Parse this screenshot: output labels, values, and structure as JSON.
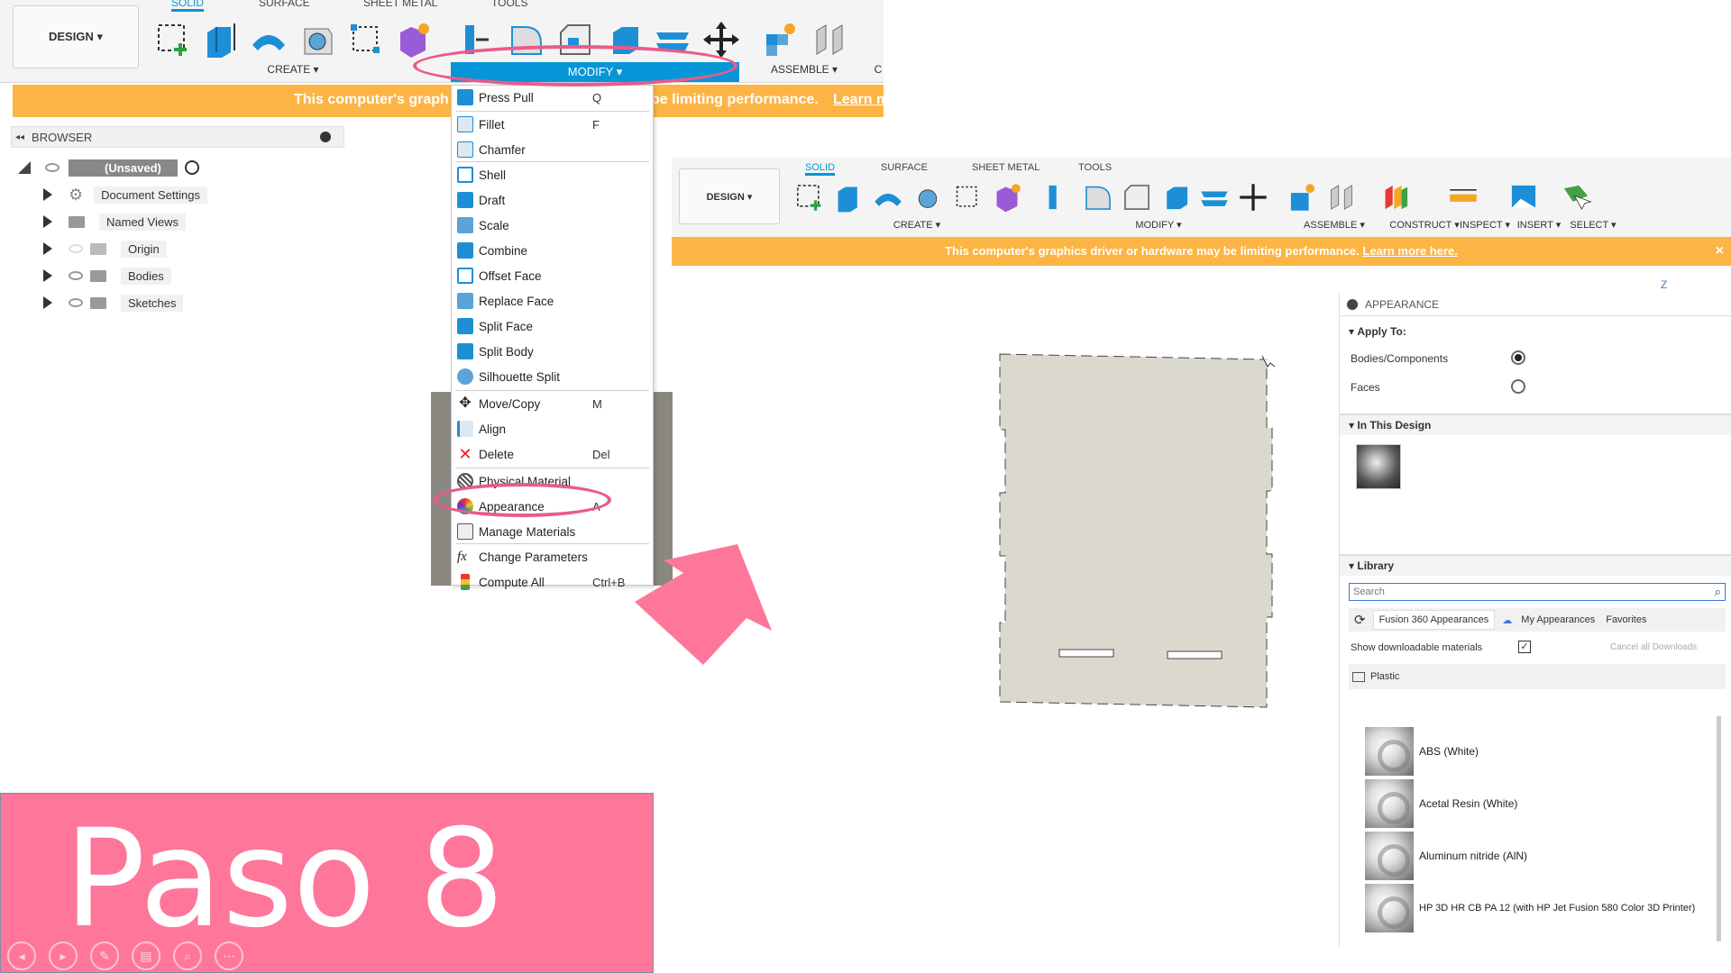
{
  "left": {
    "design_label": "DESIGN ▾",
    "tabs": [
      "SOLID",
      "SURFACE",
      "SHEET METAL",
      "TOOLS"
    ],
    "groups": {
      "create": "CREATE ▾",
      "modify": "MODIFY ▾",
      "assemble": "ASSEMBLE ▾",
      "construct_partial": "C"
    },
    "warning": "This computer's graphics driver or hardware may be limiting performance.",
    "warning_left_visible": "This computer's graph",
    "warning_right_visible": "be limiting performance.",
    "warning_link": "Learn m",
    "browser": {
      "title": "BROWSER",
      "items": [
        {
          "label": "(Unsaved)"
        },
        {
          "label": "Document Settings"
        },
        {
          "label": "Named Views"
        },
        {
          "label": "Origin"
        },
        {
          "label": "Bodies"
        },
        {
          "label": "Sketches"
        }
      ]
    },
    "modify_menu": [
      {
        "label": "Press Pull",
        "shortcut": "Q"
      },
      {
        "label": "Fillet",
        "shortcut": "F"
      },
      {
        "label": "Chamfer",
        "shortcut": ""
      },
      {
        "label": "Shell",
        "shortcut": ""
      },
      {
        "label": "Draft",
        "shortcut": ""
      },
      {
        "label": "Scale",
        "shortcut": ""
      },
      {
        "label": "Combine",
        "shortcut": ""
      },
      {
        "label": "Offset Face",
        "shortcut": ""
      },
      {
        "label": "Replace Face",
        "shortcut": ""
      },
      {
        "label": "Split Face",
        "shortcut": ""
      },
      {
        "label": "Split Body",
        "shortcut": ""
      },
      {
        "label": "Silhouette Split",
        "shortcut": ""
      },
      {
        "label": "Move/Copy",
        "shortcut": "M"
      },
      {
        "label": "Align",
        "shortcut": ""
      },
      {
        "label": "Delete",
        "shortcut": "Del"
      },
      {
        "label": "Physical Material",
        "shortcut": ""
      },
      {
        "label": "Appearance",
        "shortcut": "A"
      },
      {
        "label": "Manage Materials",
        "shortcut": ""
      },
      {
        "label": "Change Parameters",
        "shortcut": ""
      },
      {
        "label": "Compute All",
        "shortcut": "Ctrl+B"
      }
    ]
  },
  "right": {
    "design_label": "DESIGN ▾",
    "tabs": [
      "SOLID",
      "SURFACE",
      "SHEET METAL",
      "TOOLS"
    ],
    "groups": [
      "CREATE ▾",
      "MODIFY ▾",
      "ASSEMBLE ▾",
      "CONSTRUCT ▾",
      "INSPECT ▾",
      "INSERT ▾",
      "SELECT ▾"
    ],
    "warning": "This computer's graphics driver or hardware may be limiting performance.",
    "warning_link": "Learn more here.",
    "close": "×",
    "axis_label": "Z",
    "appearance": {
      "title": "APPEARANCE",
      "apply_to": "Apply To:",
      "option_bodies": "Bodies/Components",
      "option_faces": "Faces",
      "selected": "Bodies/Components",
      "in_design": "In This Design",
      "library": "Library",
      "search_placeholder": "Search",
      "lib_tabs": [
        "Fusion 360 Appearances",
        "My Appearances",
        "Favorites"
      ],
      "show_downloadable": "Show downloadable materials",
      "cancel_downloads": "Cancel all Downloads",
      "folder": "Plastic",
      "materials": [
        "ABS (White)",
        "Acetal Resin (White)",
        "Aluminum nitride (AlN)",
        "HP 3D HR CB PA 12 (with HP Jet Fusion 580 Color 3D Printer)"
      ]
    }
  },
  "step": {
    "label": "Paso 8"
  },
  "colors": {
    "accent": "#0696d7",
    "warning": "#fcb445",
    "pink": "#fe779a",
    "highlight": "#e95b8c"
  }
}
